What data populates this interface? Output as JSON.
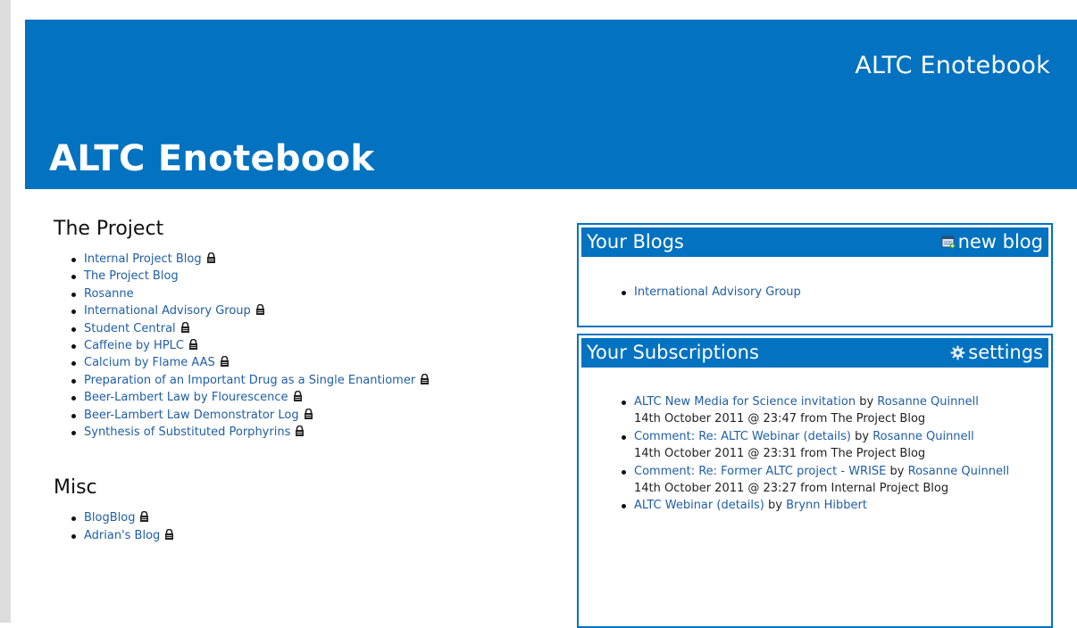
{
  "header": {
    "site_title": "ALTC Enotebook",
    "page_title": "ALTC Enotebook"
  },
  "project": {
    "heading": "The Project",
    "items": [
      {
        "label": "Internal Project Blog",
        "locked": true
      },
      {
        "label": "The Project Blog",
        "locked": false
      },
      {
        "label": "Rosanne",
        "locked": false
      },
      {
        "label": "International Advisory Group",
        "locked": true
      },
      {
        "label": "Student Central",
        "locked": true
      },
      {
        "label": "Caffeine by HPLC",
        "locked": true
      },
      {
        "label": "Calcium by Flame AAS",
        "locked": true
      },
      {
        "label": "Preparation of an Important Drug as a Single Enantiomer",
        "locked": true
      },
      {
        "label": "Beer-Lambert Law by Flourescence",
        "locked": true
      },
      {
        "label": "Beer-Lambert Law Demonstrator Log",
        "locked": true
      },
      {
        "label": "Synthesis of Substituted Porphyrins",
        "locked": true
      }
    ]
  },
  "misc": {
    "heading": "Misc",
    "items": [
      {
        "label": "BlogBlog",
        "locked": true
      },
      {
        "label": "Adrian's Blog",
        "locked": true
      }
    ]
  },
  "your_blogs": {
    "title": "Your Blogs",
    "action_label": "new blog",
    "action_icon": "new-blog-icon",
    "items": [
      {
        "label": "International Advisory Group"
      }
    ]
  },
  "subscriptions": {
    "title": "Your Subscriptions",
    "action_label": "settings",
    "action_icon": "gear-icon",
    "items": [
      {
        "link": "ALTC New Media for Science invitation",
        "by": "by",
        "author": "Rosanne Quinnell",
        "meta": "14th October 2011 @ 23:47 from The Project Blog"
      },
      {
        "link": "Comment: Re: ALTC Webinar (details)",
        "by": "by",
        "author": "Rosanne Quinnell",
        "meta": "14th October 2011 @ 23:31 from The Project Blog"
      },
      {
        "link": "Comment: Re: Former ALTC project - WRISE",
        "by": "by",
        "author": "Rosanne Quinnell",
        "meta": "14th October 2011 @ 23:27 from Internal Project Blog"
      },
      {
        "link": "ALTC Webinar (details)",
        "by": "by",
        "author": "Brynn Hibbert",
        "meta": ""
      }
    ]
  },
  "colors": {
    "brand_blue": "#0272c1",
    "link_blue": "#1f5ea6"
  }
}
